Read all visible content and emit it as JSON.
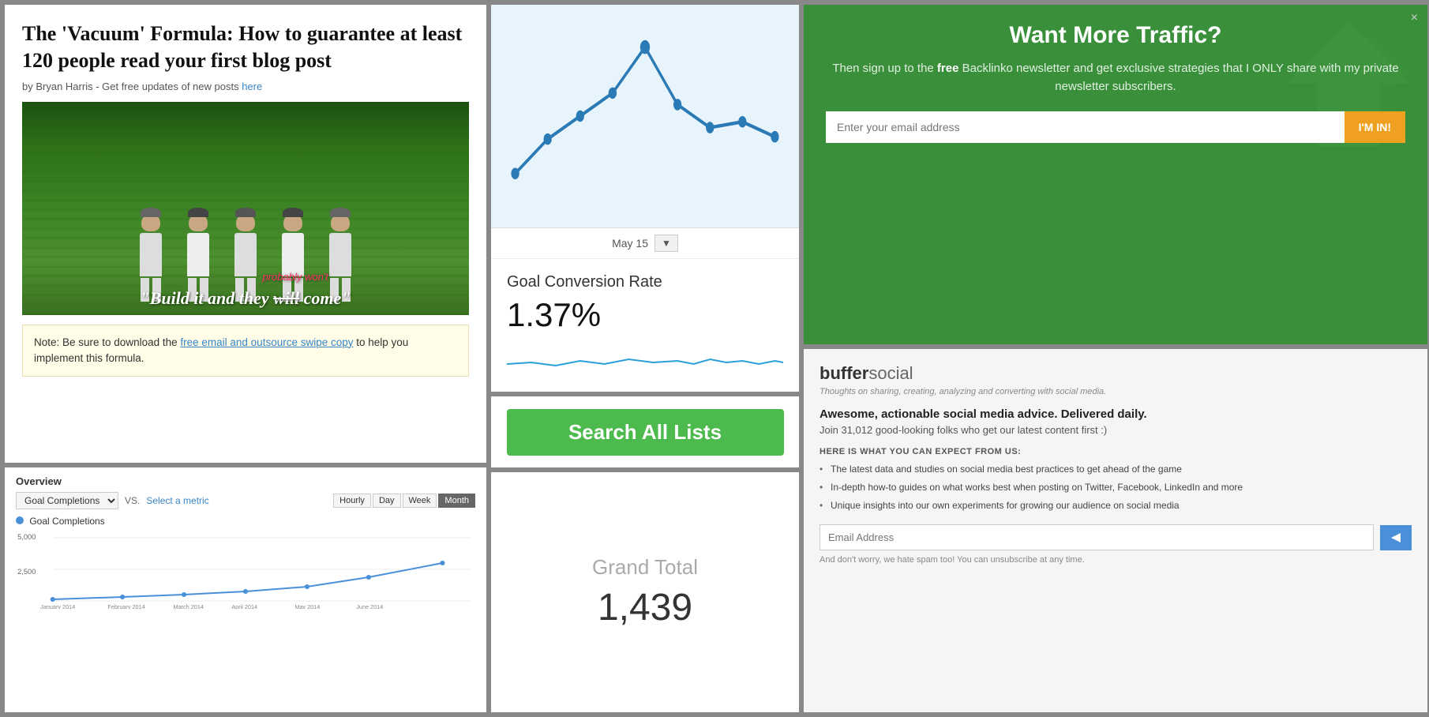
{
  "blog": {
    "title": "The 'Vacuum' Formula: How to guarantee at least 120 people read your first blog post",
    "byline": "by Bryan Harris - Get free updates of new posts",
    "byline_link": "here",
    "image_caption_pre": "\"Build it and they ",
    "image_caption_strike": "will",
    "image_caption_correction": "probably won't",
    "image_caption_post": " come\"",
    "note_pre": "Note: Be sure to download the ",
    "note_link": "free email and outsource swipe copy",
    "note_post": " to help you implement this formula."
  },
  "analytics_overview": {
    "title": "Overview",
    "metric1": "Goal Completions",
    "vs": "VS.",
    "select_metric": "Select a metric",
    "time_buttons": [
      "Hourly",
      "Day",
      "Week",
      "Month"
    ],
    "active_time": "Month",
    "legend_label": "Goal Completions",
    "y_labels": [
      "5,000",
      "2,500"
    ],
    "x_labels": [
      "January 2014",
      "February 2014",
      "March 2014",
      "April 2014",
      "May 2014",
      "June 2014"
    ]
  },
  "goal_chart": {
    "date": "May 15",
    "goal_label": "Goal Conversion Rate",
    "goal_value": "1.37%"
  },
  "search_btn": {
    "label": "Search All Lists"
  },
  "grand_total": {
    "label": "Grand Total",
    "value": "1,439"
  },
  "traffic": {
    "close": "×",
    "title": "Want More Traffic?",
    "desc_pre": "Then sign up to the ",
    "desc_free": "free",
    "desc_post": " Backlinko newsletter and get exclusive strategies that I ONLY share with my private newsletter subscribers.",
    "email_placeholder": "Enter your email address",
    "cta_label": "I'M IN!"
  },
  "buffer": {
    "logo_bold": "buffer",
    "logo_social": "social",
    "tagline": "Thoughts on sharing, creating, analyzing and converting with social media.",
    "heading": "Awesome, actionable social media advice. Delivered daily.",
    "subheading": "Join 31,012 good-looking folks who get our latest content first :)",
    "list_title": "HERE IS WHAT YOU CAN EXPECT FROM US:",
    "list_items": [
      "The latest data and studies on social media best practices to get ahead of the game",
      "In-depth how-to guides on what works best when posting on Twitter, Facebook, LinkedIn and more",
      "Unique insights into our own experiments for growing our audience on social media"
    ],
    "email_placeholder": "Email Address",
    "send_note": "And don't worry, we hate spam too! You can unsubscribe at any time."
  }
}
